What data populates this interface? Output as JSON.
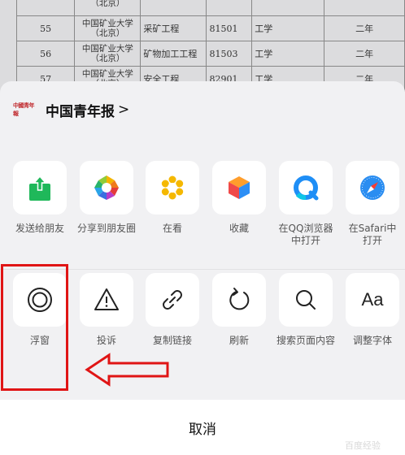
{
  "background_table": {
    "rows": [
      {
        "no": "",
        "school": "（北京）",
        "major": "",
        "code": "",
        "type": "",
        "years": ""
      },
      {
        "no": "55",
        "school": "中国矿业大学（北京）",
        "major": "采矿工程",
        "code": "81501",
        "type": "工学",
        "years": "二年"
      },
      {
        "no": "56",
        "school": "中国矿业大学（北京）",
        "major": "矿物加工工程",
        "code": "81503",
        "type": "工学",
        "years": "二年"
      },
      {
        "no": "57",
        "school": "中国矿业大学（北京）",
        "major": "安全工程",
        "code": "82901",
        "type": "工学",
        "years": "二年"
      }
    ]
  },
  "header": {
    "logo_text": "中國青年報",
    "title": "中国青年报",
    "chevron": ">"
  },
  "row1": [
    {
      "label": "发送给朋友",
      "icon": "share-to-friend-icon"
    },
    {
      "label": "分享到朋友圈",
      "icon": "moments-icon"
    },
    {
      "label": "在看",
      "icon": "wow-icon"
    },
    {
      "label": "收藏",
      "icon": "favorite-cube-icon"
    },
    {
      "label": "在QQ浏览器\n中打开",
      "icon": "qq-browser-icon"
    },
    {
      "label": "在Safari中\n打开",
      "icon": "safari-icon"
    }
  ],
  "row2": [
    {
      "label": "浮窗",
      "icon": "float-window-icon"
    },
    {
      "label": "投诉",
      "icon": "warning-icon"
    },
    {
      "label": "复制链接",
      "icon": "link-icon"
    },
    {
      "label": "刷新",
      "icon": "refresh-icon"
    },
    {
      "label": "搜索页面内容",
      "icon": "search-icon"
    },
    {
      "label": "调整字体",
      "icon": "font-icon",
      "glyph": "Aa"
    }
  ],
  "cancel": {
    "label": "取消"
  },
  "watermark": "百度经验",
  "colors": {
    "annotation": "#e01515",
    "share_green": "#1fb85a",
    "wow_yellow": "#f5b800",
    "qq_blue": "#1e8ef6",
    "safari_blue": "#2a8df1"
  }
}
